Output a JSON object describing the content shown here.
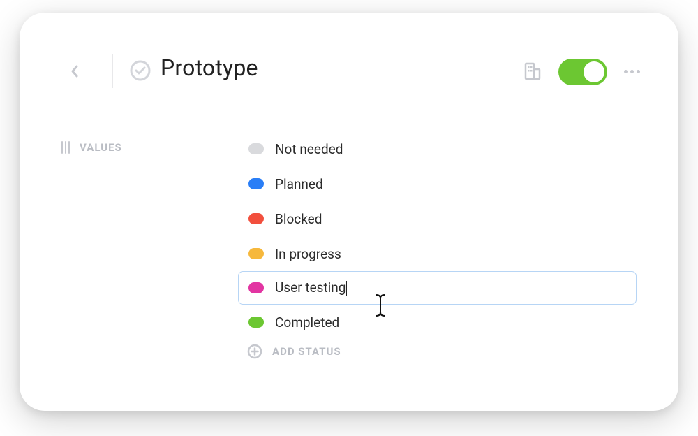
{
  "header": {
    "title": "Prototype",
    "toggle_on": true
  },
  "sidebar": {
    "section_label": "VALUES"
  },
  "statuses": [
    {
      "label": "Not needed",
      "color": "#d9dadd",
      "editing": false
    },
    {
      "label": "Planned",
      "color": "#2a7ef6",
      "editing": false
    },
    {
      "label": "Blocked",
      "color": "#f24f3d",
      "editing": false
    },
    {
      "label": "In progress",
      "color": "#f6b83c",
      "editing": false
    },
    {
      "label": "User testing",
      "color": "#e235a2",
      "editing": true
    },
    {
      "label": "Completed",
      "color": "#6cc732",
      "editing": false
    }
  ],
  "actions": {
    "add_status_label": "ADD STATUS"
  },
  "icons": {
    "back": "chevron-left-icon",
    "status": "check-circle-icon",
    "building": "building-icon",
    "more": "more-horizontal-icon",
    "drag": "drag-handle-icon",
    "add": "plus-circle-icon"
  }
}
